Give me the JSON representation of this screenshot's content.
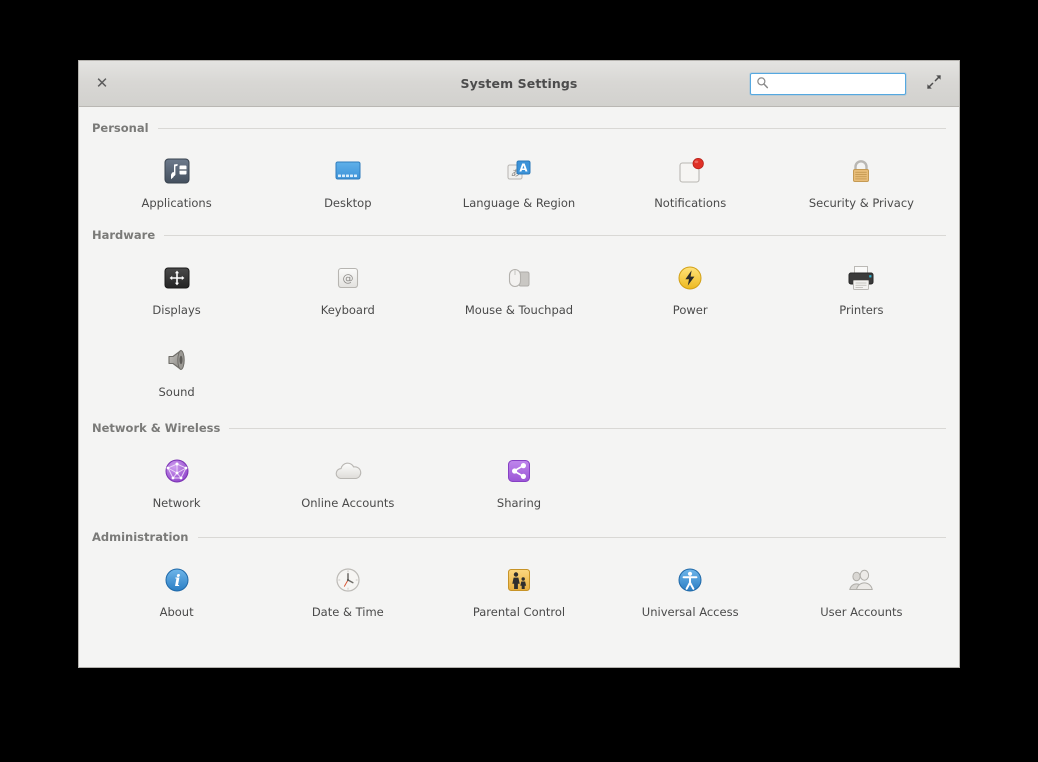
{
  "window": {
    "title": "System Settings",
    "close_label": "✕",
    "close_icon": "close-icon",
    "expand_icon": "expand-diagonal-icon"
  },
  "search": {
    "value": "",
    "placeholder": "",
    "icon": "search-icon"
  },
  "sections": [
    {
      "title": "Personal",
      "items": [
        {
          "label": "Applications",
          "icon": "applications-icon"
        },
        {
          "label": "Desktop",
          "icon": "desktop-monitor-icon"
        },
        {
          "label": "Language & Region",
          "icon": "language-region-icon"
        },
        {
          "label": "Notifications",
          "icon": "notifications-icon"
        },
        {
          "label": "Security & Privacy",
          "icon": "padlock-icon"
        }
      ]
    },
    {
      "title": "Hardware",
      "items": [
        {
          "label": "Displays",
          "icon": "displays-icon"
        },
        {
          "label": "Keyboard",
          "icon": "keyboard-key-icon"
        },
        {
          "label": "Mouse & Touchpad",
          "icon": "mouse-touchpad-icon"
        },
        {
          "label": "Power",
          "icon": "power-bolt-icon"
        },
        {
          "label": "Printers",
          "icon": "printer-icon"
        },
        {
          "label": "Sound",
          "icon": "speaker-icon"
        }
      ]
    },
    {
      "title": "Network & Wireless",
      "items": [
        {
          "label": "Network",
          "icon": "network-globe-icon"
        },
        {
          "label": "Online Accounts",
          "icon": "cloud-icon"
        },
        {
          "label": "Sharing",
          "icon": "share-nodes-icon"
        }
      ]
    },
    {
      "title": "Administration",
      "items": [
        {
          "label": "About",
          "icon": "info-circle-icon"
        },
        {
          "label": "Date & Time",
          "icon": "clock-icon"
        },
        {
          "label": "Parental Control",
          "icon": "parental-control-icon"
        },
        {
          "label": "Universal Access",
          "icon": "universal-access-icon"
        },
        {
          "label": "User Accounts",
          "icon": "user-accounts-icon"
        }
      ]
    }
  ],
  "colors": {
    "window_bg": "#f4f4f3",
    "titlebar_top": "#e4e3e1",
    "titlebar_bottom": "#d2d1ce",
    "section_title": "#7a7a78",
    "label_text": "#4a4a4a",
    "search_focus_border": "#55a8e0",
    "accent_blue": "#3c93d9",
    "accent_purple": "#a963d8",
    "accent_yellow": "#f5cb36",
    "accent_red": "#e03127",
    "accent_tan": "#e3b26a"
  }
}
